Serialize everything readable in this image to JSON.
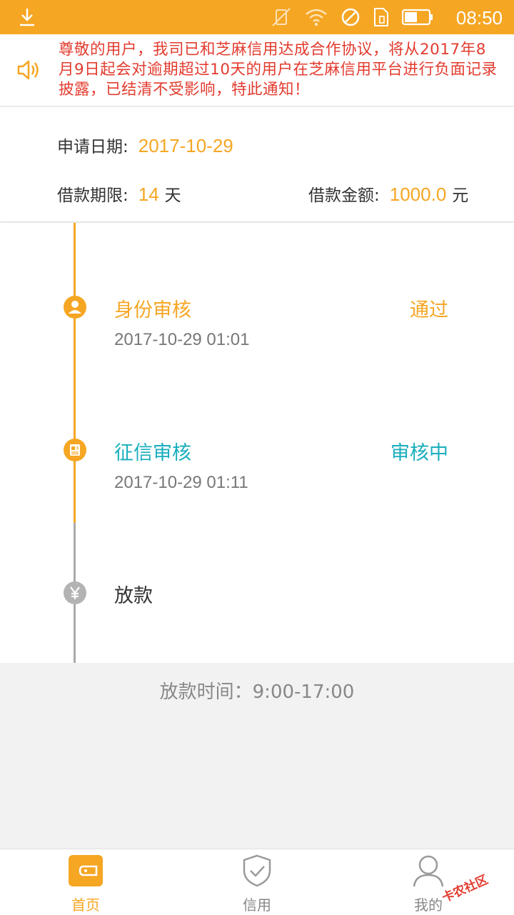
{
  "status_bar": {
    "time": "08:50",
    "icons": [
      "download-icon",
      "vibrate-off-icon",
      "wifi-icon",
      "do-not-disturb-icon",
      "sim-icon",
      "battery-icon"
    ]
  },
  "notice": {
    "icon": "speaker-icon",
    "text": "尊敬的用户，我司已和芝麻信用达成合作协议，将从2017年8月9日起会对逾期超过10天的用户在芝麻信用平台进行负面记录披露，已结清不受影响，特此通知！",
    "color": "#e23b2e"
  },
  "info": {
    "apply_date_label": "申请日期:",
    "apply_date_value": "2017-10-29",
    "term_label": "借款期限:",
    "term_value": "14",
    "term_unit": "天",
    "amount_label": "借款金额:",
    "amount_value": "1000.0",
    "amount_unit": "元"
  },
  "steps": [
    {
      "title": "身份审核",
      "status": "通过",
      "time": "2017-10-29 01:01",
      "icon": "user-icon",
      "color": "#f5a623"
    },
    {
      "title": "征信审核",
      "status": "审核中",
      "time": "2017-10-29 01:11",
      "icon": "id-card-icon",
      "color": "#1aaebd"
    },
    {
      "title": "放款",
      "status": "",
      "time": "",
      "icon": "yen-icon",
      "color": "#333333"
    }
  ],
  "loan_time": "放款时间：9:00-17:00",
  "tabbar": {
    "items": [
      {
        "label": "首页",
        "icon": "wallet-icon",
        "active": true
      },
      {
        "label": "信用",
        "icon": "shield-check-icon",
        "active": false
      },
      {
        "label": "我的",
        "icon": "person-icon",
        "active": false
      }
    ]
  },
  "watermark": "卡农社区",
  "colors": {
    "accent": "#f5a623",
    "teal": "#1aaebd",
    "inactive": "#a9a9a9"
  }
}
